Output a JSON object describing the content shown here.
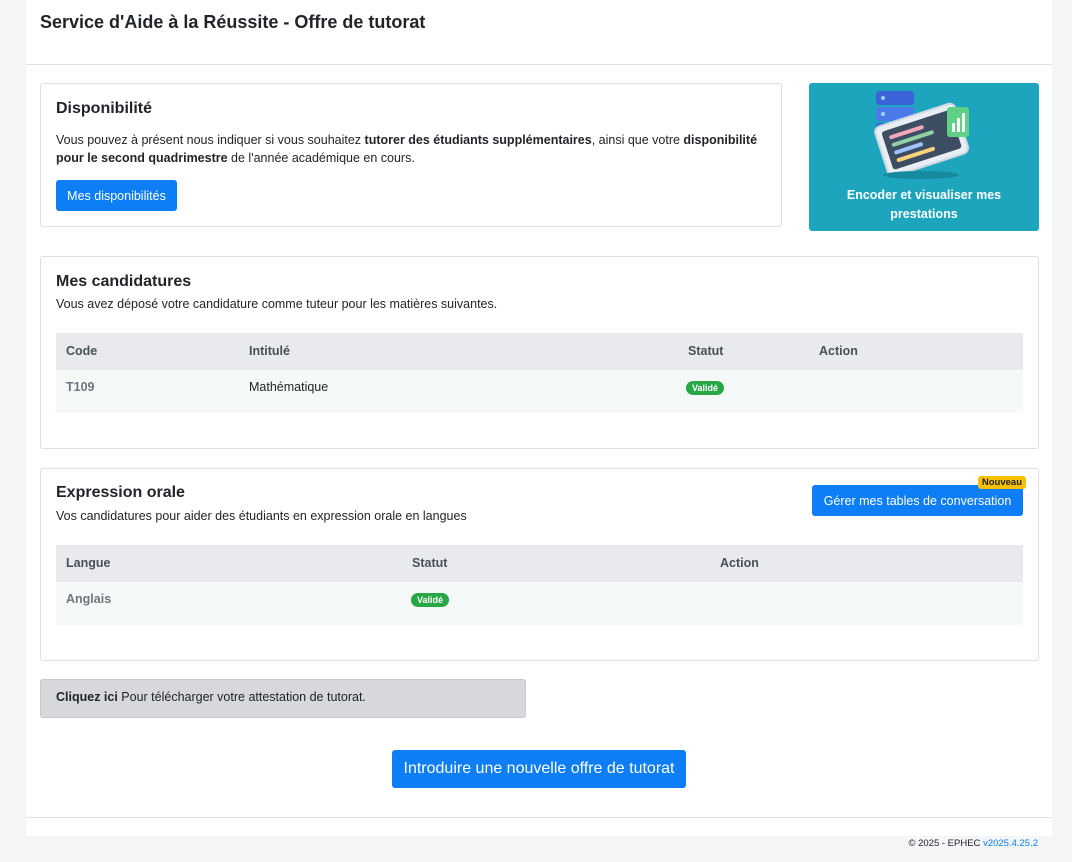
{
  "page": {
    "title": "Service d'Aide à la Réussite - Offre de tutorat"
  },
  "availability": {
    "title": "Disponibilité",
    "text_1": "Vous pouvez à présent nous indiquer si vous souhaitez ",
    "text_bold_1": "tutorer des étudiants supplémentaires",
    "text_2": ", ainsi que votre ",
    "text_bold_2": "disponibilité pour le second quadrimestre",
    "text_3": " de l'année académique en cours.",
    "button": "Mes disponibilités"
  },
  "tile": {
    "line1": "Encoder et visualiser mes",
    "line2": "prestations",
    "icon": "tablet-server-illustration"
  },
  "applications": {
    "title": "Mes candidatures",
    "subtitle": "Vous avez déposé votre candidature comme tuteur pour les matières suivantes.",
    "headers": {
      "code": "Code",
      "title": "Intitulé",
      "status": "Statut",
      "action": "Action"
    },
    "rows": [
      {
        "code": "T109",
        "title": "Mathématique",
        "status": "Validé",
        "action": ""
      }
    ]
  },
  "oral": {
    "title": "Expression orale",
    "subtitle": "Vos candidatures pour aider des étudiants en expression orale en langues",
    "button": "Gérer mes tables de conversation",
    "badge": "Nouveau",
    "headers": {
      "language": "Langue",
      "status": "Statut",
      "action": "Action"
    },
    "rows": [
      {
        "language": "Anglais",
        "status": "Validé",
        "action": ""
      }
    ]
  },
  "attestation": {
    "bold": "Cliquez ici",
    "text": " Pour télécharger votre attestation de tutorat."
  },
  "new_offer": {
    "button": "Introduire une nouvelle offre de tutorat"
  },
  "footer": {
    "copyright": "© 2025 - EPHEC ",
    "version": "v2025.4.25.2"
  },
  "colors": {
    "primary": "#0d7ef5",
    "tile": "#1da5bd",
    "success": "#28a745",
    "warning": "#f6c000"
  }
}
